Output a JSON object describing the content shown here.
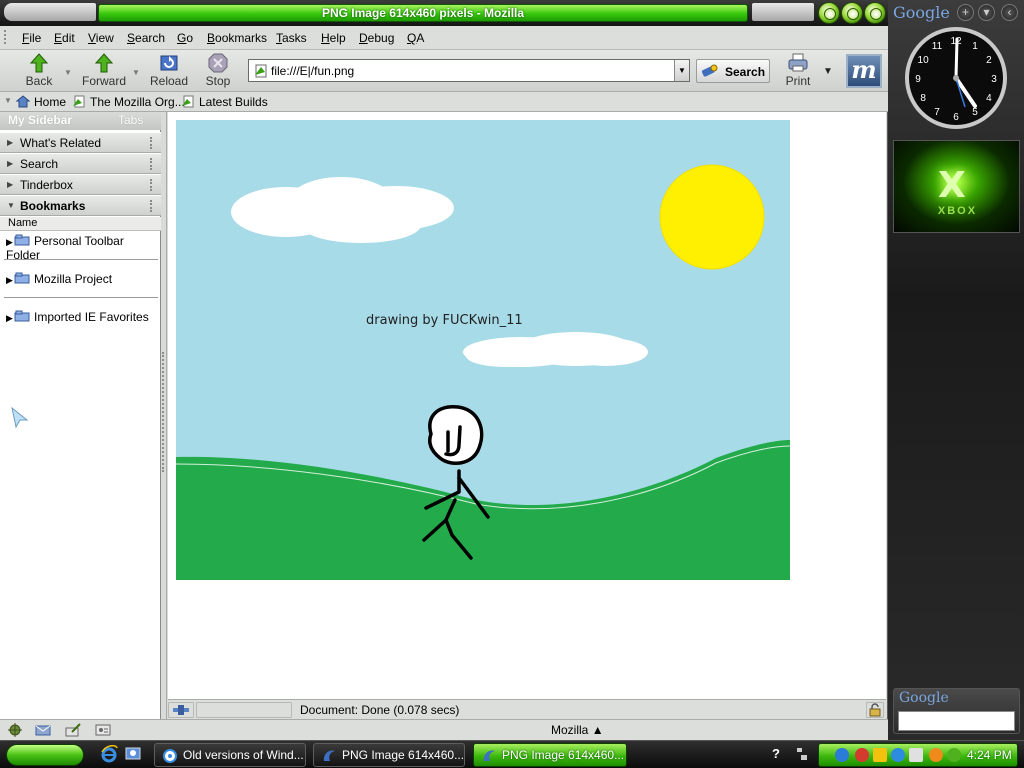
{
  "window": {
    "title": "PNG Image 614x460 pixels - Mozilla"
  },
  "menu": {
    "items": [
      {
        "label": "File",
        "u": "F",
        "rest": "ile"
      },
      {
        "label": "Edit",
        "u": "E",
        "rest": "dit"
      },
      {
        "label": "View",
        "u": "V",
        "rest": "iew"
      },
      {
        "label": "Search",
        "u": "S",
        "rest": "earch"
      },
      {
        "label": "Go",
        "u": "G",
        "rest": "o"
      },
      {
        "label": "Bookmarks",
        "u": "B",
        "rest": "ookmarks"
      },
      {
        "label": "Tasks",
        "u": "T",
        "rest": "asks"
      },
      {
        "label": "Help",
        "u": "H",
        "rest": "elp"
      },
      {
        "label": "Debug",
        "u": "D",
        "rest": "ebug"
      },
      {
        "label": "QA",
        "u": "Q",
        "rest": "A"
      }
    ]
  },
  "nav": {
    "back": "Back",
    "forward": "Forward",
    "reload": "Reload",
    "stop": "Stop",
    "url": "file:///E|/fun.png",
    "search": "Search",
    "print": "Print"
  },
  "personal_toolbar": {
    "home": "Home",
    "mozilla_org": "The Mozilla Org...",
    "latest_builds": "Latest Builds"
  },
  "sidebar": {
    "title": "My Sidebar",
    "tabs": "Tabs",
    "panels": {
      "whats_related": "What's Related",
      "search": "Search",
      "tinderbox": "Tinderbox",
      "bookmarks": "Bookmarks"
    },
    "column_name": "Name",
    "bookmarks": [
      "Personal Toolbar Folder",
      "Mozilla Project",
      "Imported IE Favorites"
    ]
  },
  "content": {
    "drawing_caption": "drawing by FUCKwin_11"
  },
  "status": {
    "text": "Document: Done (0.078 secs)",
    "component_bar": "Mozilla"
  },
  "desktop_sidebar": {
    "google_logo": "Google",
    "clock_numbers": [
      "12",
      "1",
      "2",
      "3",
      "4",
      "5",
      "6",
      "7",
      "8",
      "9",
      "10",
      "11"
    ],
    "xbox_text": "XBOX",
    "search_logo": "Google"
  },
  "taskbar": {
    "tasks": [
      {
        "label": "Old versions of Wind...",
        "state": "inactive"
      },
      {
        "label": "PNG Image 614x460...",
        "state": "inactive"
      },
      {
        "label": "PNG Image 614x460...",
        "state": "active"
      }
    ],
    "clock": "4:24 PM",
    "help": "?"
  },
  "colors": {
    "title_green": "#37c80c",
    "sky": "#a7dbe8",
    "grass": "#23ab4b",
    "sun": "#ffef00"
  }
}
